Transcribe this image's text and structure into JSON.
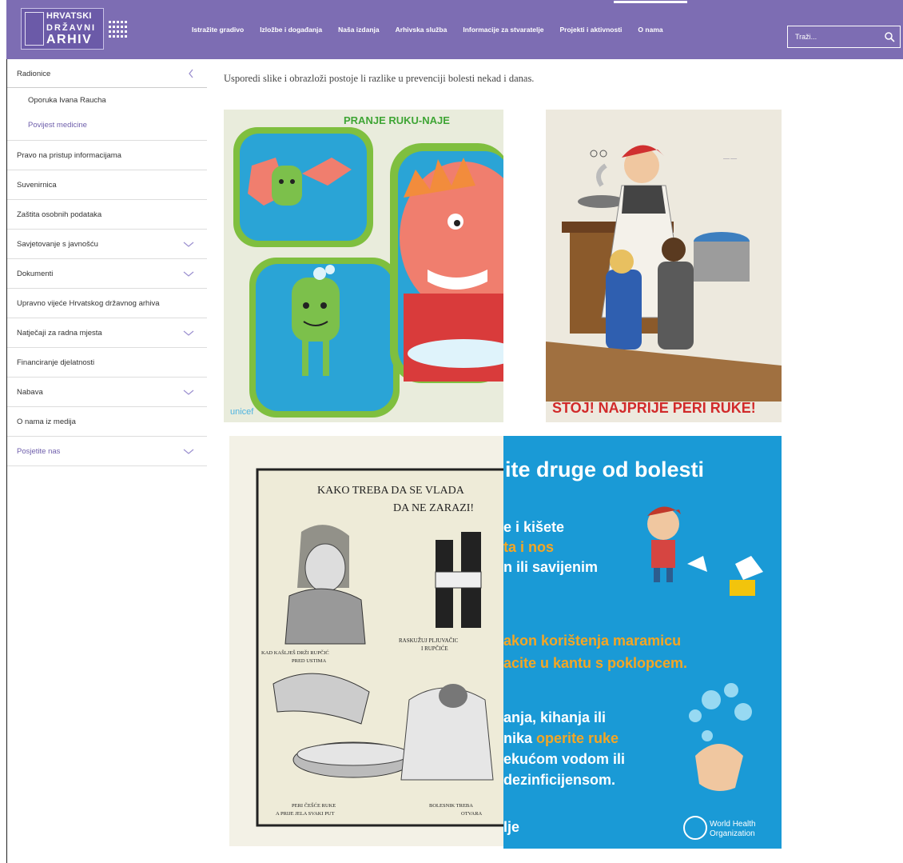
{
  "header": {
    "logo": {
      "line1": "HRVATSKI",
      "line2": "DRŽAVNI",
      "line3": "ARHIV"
    },
    "nav": [
      {
        "label": "Istražite gradivo"
      },
      {
        "label": "Izložbe i događanja"
      },
      {
        "label": "Naša izdanja"
      },
      {
        "label": "Arhivska služba"
      },
      {
        "label": "Informacije za stvaratelje"
      },
      {
        "label": "Projekti i aktivnosti"
      },
      {
        "label": "O nama"
      }
    ],
    "search": {
      "placeholder": "Traži..."
    }
  },
  "sidebar": {
    "section": "Radionice",
    "subitems": [
      "Oporuka Ivana Raucha",
      "Povijest medicine"
    ],
    "items": [
      {
        "label": "Pravo na pristup informacijama",
        "expandable": false
      },
      {
        "label": "Suvenirnica",
        "expandable": false
      },
      {
        "label": "Zaštita osobnih podataka",
        "expandable": false
      },
      {
        "label": "Savjetovanje s javnošću",
        "expandable": true
      },
      {
        "label": "Dokumenti",
        "expandable": true
      },
      {
        "label": "Upravno vijeće Hrvatskog državnog arhiva",
        "expandable": false
      },
      {
        "label": "Natječaji za radna mjesta",
        "expandable": true
      },
      {
        "label": "Financiranje djelatnosti",
        "expandable": false
      },
      {
        "label": "Nabava",
        "expandable": true
      },
      {
        "label": "O nama iz medija",
        "expandable": false
      },
      {
        "label": "Posjetite nas",
        "expandable": true
      }
    ]
  },
  "main": {
    "intro": "Usporedi slike i obrazloži postoje li razlike u prevenciji bolesti nekad i danas.",
    "images": {
      "unicef": {
        "title": "PRANJE RUKU-NAJE",
        "brand": "unicef"
      },
      "stoj": {
        "caption": "STOJ! NAJPRIJE PERI RUKE!"
      },
      "kako": {
        "title1": "KAKO TREBA DA SE VLADA",
        "title2": "DA NE ZARAZI!",
        "label_a": "KAD KAŠLJEŠ DRŽI RUPČIĆ",
        "label_a2": "PRED USTIMA",
        "label_b": "RASKUŽUJ PLJUVAČIC",
        "label_b2": "I RUPČIĆE",
        "label_c": "PERI ČEŠĆE RUKE",
        "label_c2": "A PRIJE JELA SVAKI PUT",
        "label_d": "BOLESNIK TREBA",
        "label_d2": "OTVARA"
      },
      "who": {
        "title": "ite druge od bolesti",
        "l1": "e i kišete",
        "l2": "ta i nos",
        "l3": "n ili savijenim",
        "l4": "akon korištenja maramicu",
        "l5": "acite u kantu s poklopcem.",
        "l6": "anja, kihanja ili",
        "l7a": "nika ",
        "l7b": "operite ruke",
        "l8": "ekućom vodom ili",
        "l9": "dezinficijensom.",
        "l10": "lje",
        "org1": "World Health",
        "org2": "Organization"
      }
    }
  },
  "colors": {
    "header": "#7d6db3",
    "accent": "#6e5eab",
    "who_blue": "#1a9ad6",
    "who_orange": "#f5a623"
  }
}
